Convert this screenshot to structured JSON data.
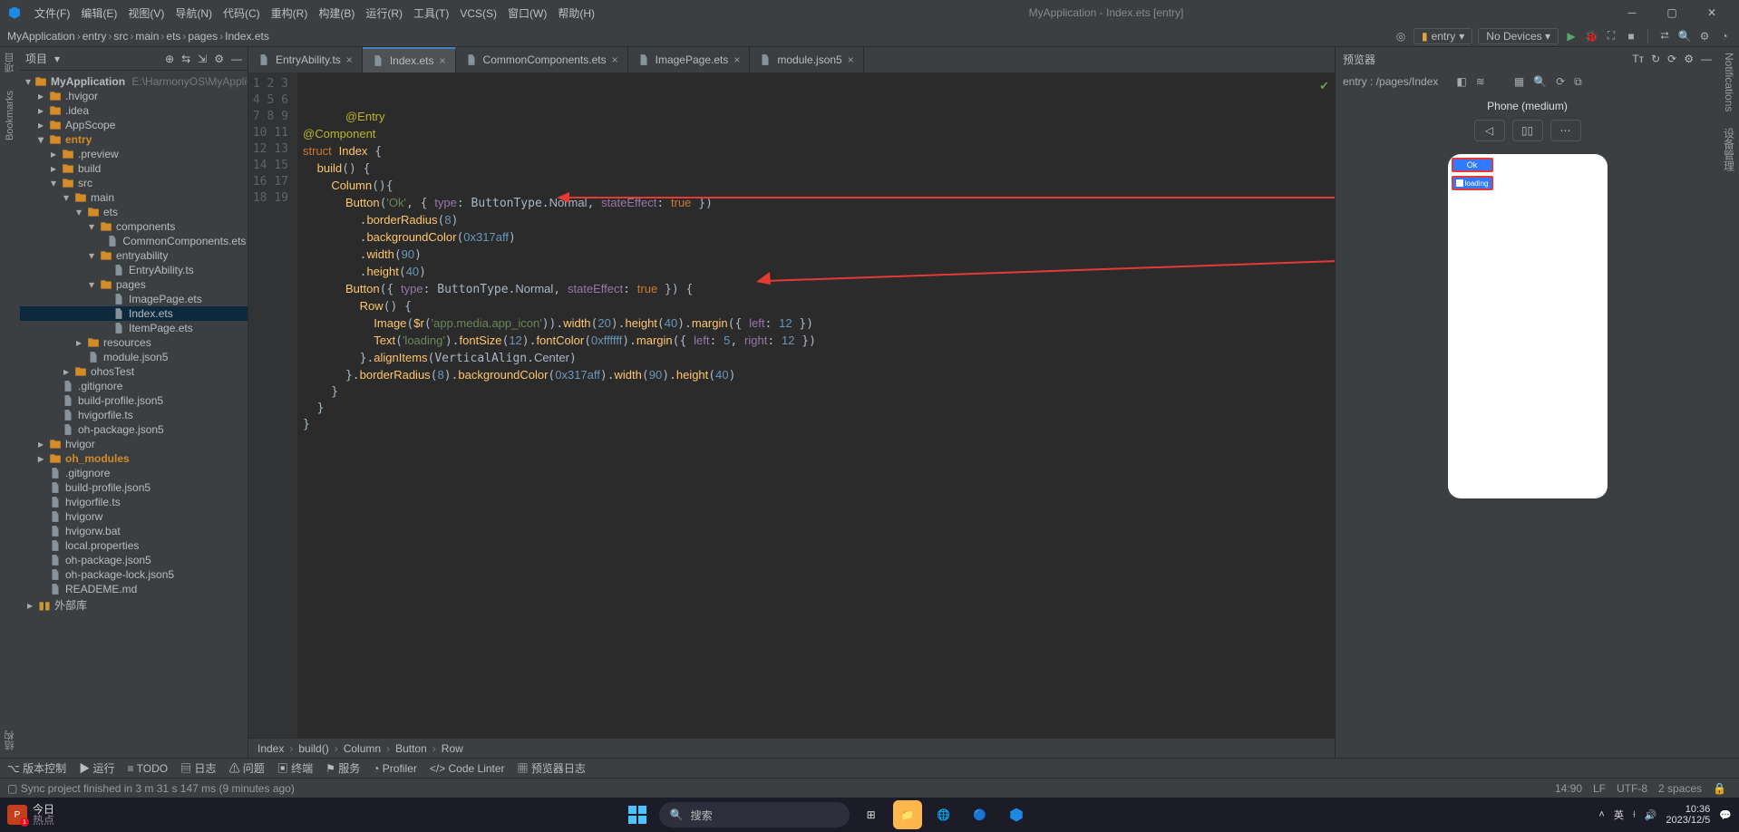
{
  "window_title": "MyApplication - Index.ets [entry]",
  "menu": [
    "文件(F)",
    "编辑(E)",
    "视图(V)",
    "导航(N)",
    "代码(C)",
    "重构(R)",
    "构建(B)",
    "运行(R)",
    "工具(T)",
    "VCS(S)",
    "窗口(W)",
    "帮助(H)"
  ],
  "breadcrumbs": [
    "MyApplication",
    "entry",
    "src",
    "main",
    "ets",
    "pages",
    "Index.ets"
  ],
  "run_config": "entry",
  "device_selector": "No Devices",
  "project_label": "项目",
  "tree": {
    "root": {
      "name": "MyApplication",
      "path": "E:\\HarmonyOS\\MyApplication"
    },
    "nodes": [
      {
        "d": 1,
        "t": "dir",
        "exp": false,
        "name": ".hvigor"
      },
      {
        "d": 1,
        "t": "dir",
        "exp": false,
        "name": ".idea"
      },
      {
        "d": 1,
        "t": "dir",
        "exp": false,
        "name": "AppScope"
      },
      {
        "d": 1,
        "t": "dir",
        "exp": true,
        "name": "entry",
        "hi": true
      },
      {
        "d": 2,
        "t": "dir",
        "exp": false,
        "name": ".preview"
      },
      {
        "d": 2,
        "t": "dir",
        "exp": false,
        "name": "build"
      },
      {
        "d": 2,
        "t": "dir",
        "exp": true,
        "name": "src"
      },
      {
        "d": 3,
        "t": "dir",
        "exp": true,
        "name": "main"
      },
      {
        "d": 4,
        "t": "dir",
        "exp": true,
        "name": "ets"
      },
      {
        "d": 5,
        "t": "dir",
        "exp": true,
        "name": "components"
      },
      {
        "d": 6,
        "t": "file",
        "name": "CommonComponents.ets"
      },
      {
        "d": 5,
        "t": "dir",
        "exp": true,
        "name": "entryability"
      },
      {
        "d": 6,
        "t": "file",
        "name": "EntryAbility.ts"
      },
      {
        "d": 5,
        "t": "dir",
        "exp": true,
        "name": "pages"
      },
      {
        "d": 6,
        "t": "file",
        "name": "ImagePage.ets"
      },
      {
        "d": 6,
        "t": "file",
        "name": "Index.ets",
        "sel": true
      },
      {
        "d": 6,
        "t": "file",
        "name": "ItemPage.ets"
      },
      {
        "d": 4,
        "t": "dir",
        "exp": false,
        "name": "resources"
      },
      {
        "d": 4,
        "t": "file",
        "name": "module.json5"
      },
      {
        "d": 3,
        "t": "dir",
        "exp": false,
        "name": "ohosTest"
      },
      {
        "d": 2,
        "t": "file",
        "name": ".gitignore"
      },
      {
        "d": 2,
        "t": "file",
        "name": "build-profile.json5"
      },
      {
        "d": 2,
        "t": "file",
        "name": "hvigorfile.ts"
      },
      {
        "d": 2,
        "t": "file",
        "name": "oh-package.json5"
      },
      {
        "d": 1,
        "t": "dir",
        "exp": false,
        "name": "hvigor"
      },
      {
        "d": 1,
        "t": "dir",
        "exp": false,
        "name": "oh_modules",
        "hi": true
      },
      {
        "d": 1,
        "t": "file",
        "name": ".gitignore"
      },
      {
        "d": 1,
        "t": "file",
        "name": "build-profile.json5"
      },
      {
        "d": 1,
        "t": "file",
        "name": "hvigorfile.ts"
      },
      {
        "d": 1,
        "t": "file",
        "name": "hvigorw"
      },
      {
        "d": 1,
        "t": "file",
        "name": "hvigorw.bat"
      },
      {
        "d": 1,
        "t": "file",
        "name": "local.properties"
      },
      {
        "d": 1,
        "t": "file",
        "name": "oh-package.json5"
      },
      {
        "d": 1,
        "t": "file",
        "name": "oh-package-lock.json5"
      },
      {
        "d": 1,
        "t": "file",
        "name": "READEME.md"
      }
    ],
    "ext_libs": "外部库"
  },
  "tabs": [
    {
      "name": "EntryAbility.ts",
      "active": false
    },
    {
      "name": "Index.ets",
      "active": true
    },
    {
      "name": "CommonComponents.ets",
      "active": false
    },
    {
      "name": "ImagePage.ets",
      "active": false
    },
    {
      "name": "module.json5",
      "active": false
    }
  ],
  "code_breadcrumb": [
    "Index",
    "build()",
    "Column",
    "Button",
    "Row"
  ],
  "code_lines": 19,
  "code": [
    "<span class='k-dec'>@Entry</span>",
    "<span class='k-dec'>@Component</span>",
    "<span class='k-kw'>struct</span> <span class='k-type'>Index</span> {",
    "  <span class='k-fn'>build</span>() {",
    "    <span class='k-type'>Column</span>(){",
    "      <span class='k-type'>Button</span>(<span class='k-str'>'Ok'</span>, { <span class='k-prop'>type</span>: ButtonType.<span class='k-id'>Normal</span>, <span class='k-prop'>stateEffect</span>: <span class='k-kw'>true</span> })",
    "        .<span class='k-fn'>borderRadius</span>(<span class='k-num'>8</span>)",
    "        .<span class='k-fn'>backgroundColor</span>(<span class='k-num'>0x317aff</span>)",
    "        .<span class='k-fn'>width</span>(<span class='k-num'>90</span>)",
    "        .<span class='k-fn'>height</span>(<span class='k-num'>40</span>)",
    "      <span class='k-type'>Button</span>({ <span class='k-prop'>type</span>: ButtonType.<span class='k-id'>Normal</span>, <span class='k-prop'>stateEffect</span>: <span class='k-kw'>true</span> }) {",
    "        <span class='k-type'>Row</span>() {",
    "          <span class='k-type'>Image</span>(<span class='k-fn'>$r</span>(<span class='k-str'>'app.media.app_icon'</span>)).<span class='k-fn'>width</span>(<span class='k-num'>20</span>).<span class='k-fn'>height</span>(<span class='k-num'>40</span>).<span class='k-fn'>margin</span>({ <span class='k-prop'>left</span>: <span class='k-num'>12</span> })",
    "          <span class='k-type'>Text</span>(<span class='k-str'>'loading'</span>).<span class='k-fn'>fontSize</span>(<span class='k-num'>12</span>).<span class='k-fn'>fontColor</span>(<span class='k-num'>0xffffff</span>).<span class='k-fn'>margin</span>({ <span class='k-prop'>left</span>: <span class='k-num'>5</span>, <span class='k-prop'>right</span>: <span class='k-num'>12</span> })",
    "        }.<span class='k-fn'>alignItems</span>(VerticalAlign.<span class='k-id'>Center</span>)",
    "      }.<span class='k-fn'>borderRadius</span>(<span class='k-num'>8</span>).<span class='k-fn'>backgroundColor</span>(<span class='k-num'>0x317aff</span>).<span class='k-fn'>width</span>(<span class='k-num'>90</span>).<span class='k-fn'>height</span>(<span class='k-num'>40</span>)",
    "    }",
    "  }",
    "}"
  ],
  "preview": {
    "title": "预览器",
    "entry_path": "entry : /pages/Index",
    "device": "Phone (medium)",
    "btn_ok": "Ok",
    "btn_loading": "loading"
  },
  "bottom_tools": [
    "版本控制",
    "运行",
    "TODO",
    "日志",
    "问题",
    "终端",
    "服务",
    "Profiler",
    "Code Linter",
    "预览器日志"
  ],
  "status_msg": "Sync project finished in 3 m 31 s 147 ms (9 minutes ago)",
  "status_right": {
    "pos": "14:90",
    "eol": "LF",
    "enc": "UTF-8",
    "indent": "2 spaces"
  },
  "taskbar": {
    "today": "今日",
    "hot": "热点",
    "search": "搜索",
    "ime": "英",
    "clock": "10:36",
    "date": "2023/12/5"
  },
  "left_strip": {
    "proj": "项目",
    "bm": "Bookmarks",
    "struct": "结构"
  },
  "right_strip": {
    "notif": "Notifications",
    "dev": "设备管理"
  }
}
